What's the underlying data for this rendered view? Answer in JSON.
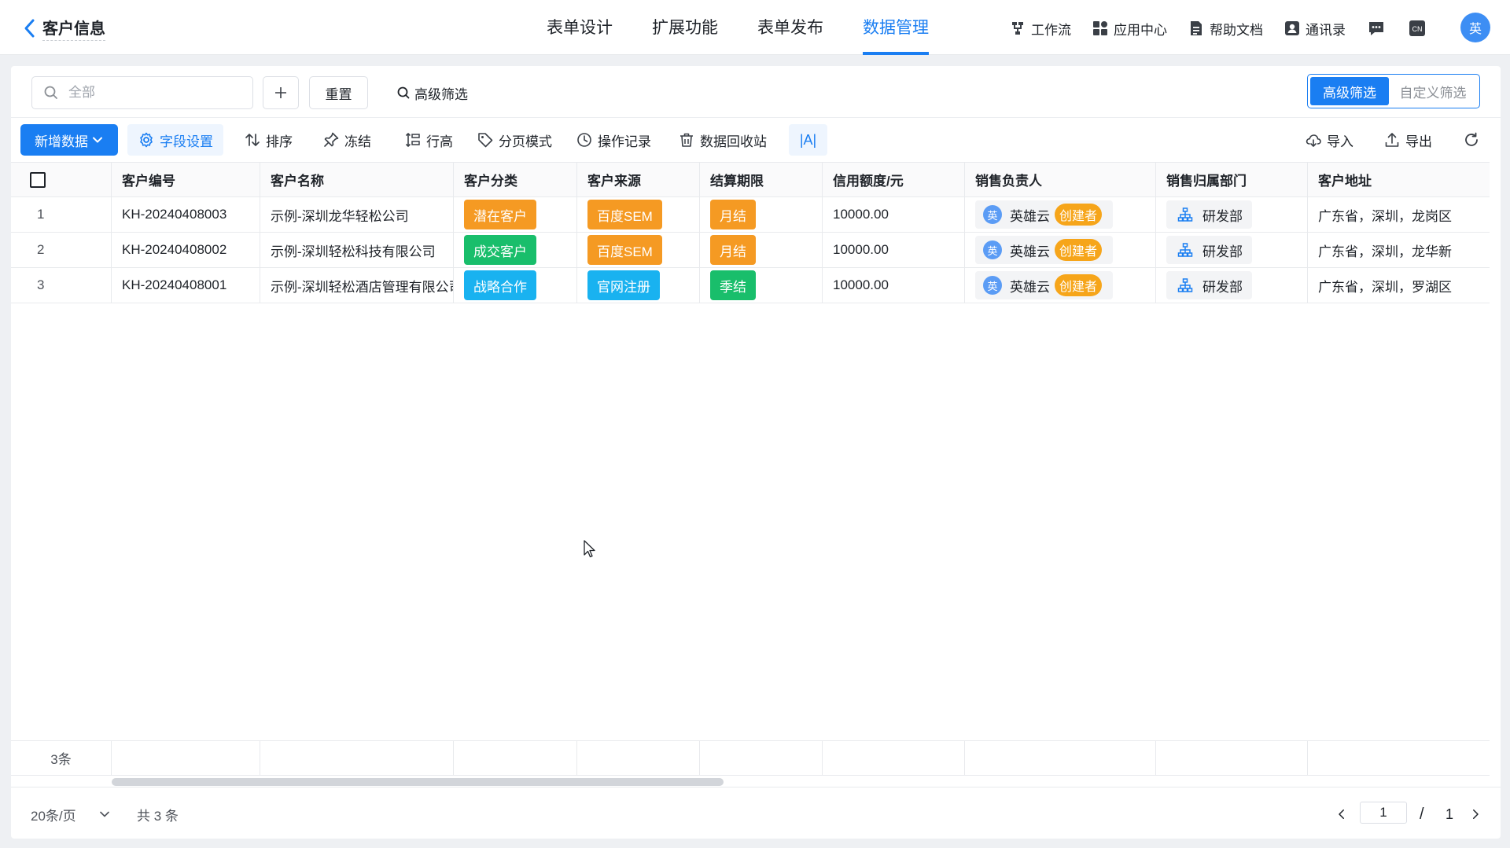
{
  "header": {
    "back_title": "客户信息",
    "tabs": [
      {
        "label": "表单设计"
      },
      {
        "label": "扩展功能"
      },
      {
        "label": "表单发布"
      },
      {
        "label": "数据管理",
        "active": true
      }
    ],
    "tools": [
      {
        "label": "工作流",
        "icon": "workflow-icon"
      },
      {
        "label": "应用中心",
        "icon": "app-center-icon"
      },
      {
        "label": "帮助文档",
        "icon": "document-icon"
      },
      {
        "label": "通讯录",
        "icon": "contacts-icon"
      }
    ],
    "lang_label": "CN",
    "user_avatar": "英"
  },
  "filter": {
    "search_placeholder": "全部",
    "reset_label": "重置",
    "advanced_link": "高级筛选",
    "segment": [
      "高级筛选",
      "自定义筛选"
    ]
  },
  "toolbar": {
    "add_label": "新增数据",
    "field_settings": "字段设置",
    "sort": "排序",
    "freeze": "冻结",
    "row_height": "行高",
    "page_mode": "分页模式",
    "operation_log": "操作记录",
    "recycle_bin": "数据回收站",
    "font_toggle": "|A|",
    "import": "导入",
    "export": "导出"
  },
  "table": {
    "columns": [
      "客户编号",
      "客户名称",
      "客户分类",
      "客户来源",
      "结算期限",
      "信用额度/元",
      "销售负责人",
      "销售归属部门",
      "客户地址"
    ],
    "rows": [
      {
        "index": "1",
        "code": "KH-20240408003",
        "name": "示例-深圳龙华轻松公司",
        "category": "潜在客户",
        "source": "百度SEM",
        "settlement": "月结",
        "credit": "10000.00",
        "sales": "英雄云",
        "sales_avatar": "英",
        "creator_badge": "创建者",
        "dept": "研发部",
        "address": "广东省，深圳，龙岗区"
      },
      {
        "index": "2",
        "code": "KH-20240408002",
        "name": "示例-深圳轻松科技有限公司",
        "category": "成交客户",
        "source": "百度SEM",
        "settlement": "月结",
        "credit": "10000.00",
        "sales": "英雄云",
        "sales_avatar": "英",
        "creator_badge": "创建者",
        "dept": "研发部",
        "address": "广东省，深圳，龙华新"
      },
      {
        "index": "3",
        "code": "KH-20240408001",
        "name": "示例-深圳轻松酒店管理有限公司",
        "category": "战略合作",
        "source": "官网注册",
        "settlement": "季结",
        "credit": "10000.00",
        "sales": "英雄云",
        "sales_avatar": "英",
        "creator_badge": "创建者",
        "dept": "研发部",
        "address": "广东省，深圳，罗湖区"
      }
    ],
    "footer_count": "3条"
  },
  "colors": {
    "primary": "#1a7ef2",
    "tag_orange": "#f59a23",
    "tag_green": "#19be6b",
    "tag_cyan": "#19b2f0",
    "creator_badge": "#f6a51a"
  },
  "tag_colors": {
    "潜在客户": "#f59a23",
    "成交客户": "#19be6b",
    "战略合作": "#19b2f0",
    "百度SEM": "#f59a23",
    "官网注册": "#19b2f0",
    "月结": "#f59a23",
    "季结": "#19be6b"
  },
  "pagination": {
    "page_size": "20条/页",
    "total": "共 3 条",
    "current_page": "1",
    "separator": "/",
    "total_pages": "1"
  }
}
